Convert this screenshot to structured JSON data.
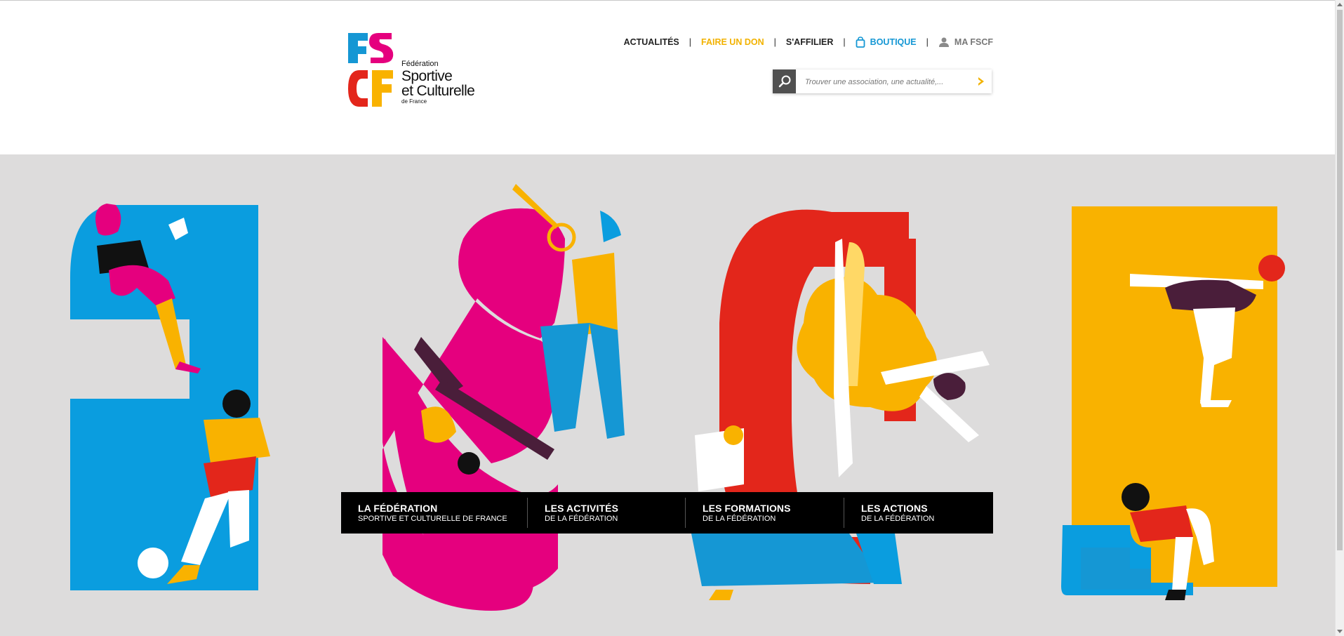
{
  "logo": {
    "line1": "Fédération",
    "line2": "Sportive",
    "line3": "et Culturelle",
    "line4": "de France",
    "mark_letters": "FSCF"
  },
  "topnav": {
    "actualites": "ACTUALITÉS",
    "separator": "|",
    "don": "FAIRE UN DON",
    "affilier": "S'AFFILIER",
    "boutique": "BOUTIQUE",
    "ma_fscf": "MA FSCF"
  },
  "search": {
    "placeholder": "Trouver une association, une actualité,..."
  },
  "menu": [
    {
      "title": "LA FÉDÉRATION",
      "subtitle": "SPORTIVE ET CULTURELLE DE FRANCE"
    },
    {
      "title": "LES ACTIVITÉS",
      "subtitle": "DE LA FÉDÉRATION"
    },
    {
      "title": "LES FORMATIONS",
      "subtitle": "DE LA FÉDÉRATION"
    },
    {
      "title": "LES ACTIONS",
      "subtitle": "DE LA FÉDÉRATION"
    }
  ],
  "colors": {
    "blue": "#0a9ddf",
    "pink": "#e5007e",
    "red": "#e3261b",
    "yellow": "#f9b200",
    "hero_bg": "#dddcdc",
    "menu_bg": "#000000",
    "don": "#f2b200",
    "boutique": "#1597d4"
  },
  "icons": {
    "search": "search-icon",
    "go": "chevron-right-icon",
    "bag": "shopping-bag-icon",
    "user": "user-icon"
  }
}
